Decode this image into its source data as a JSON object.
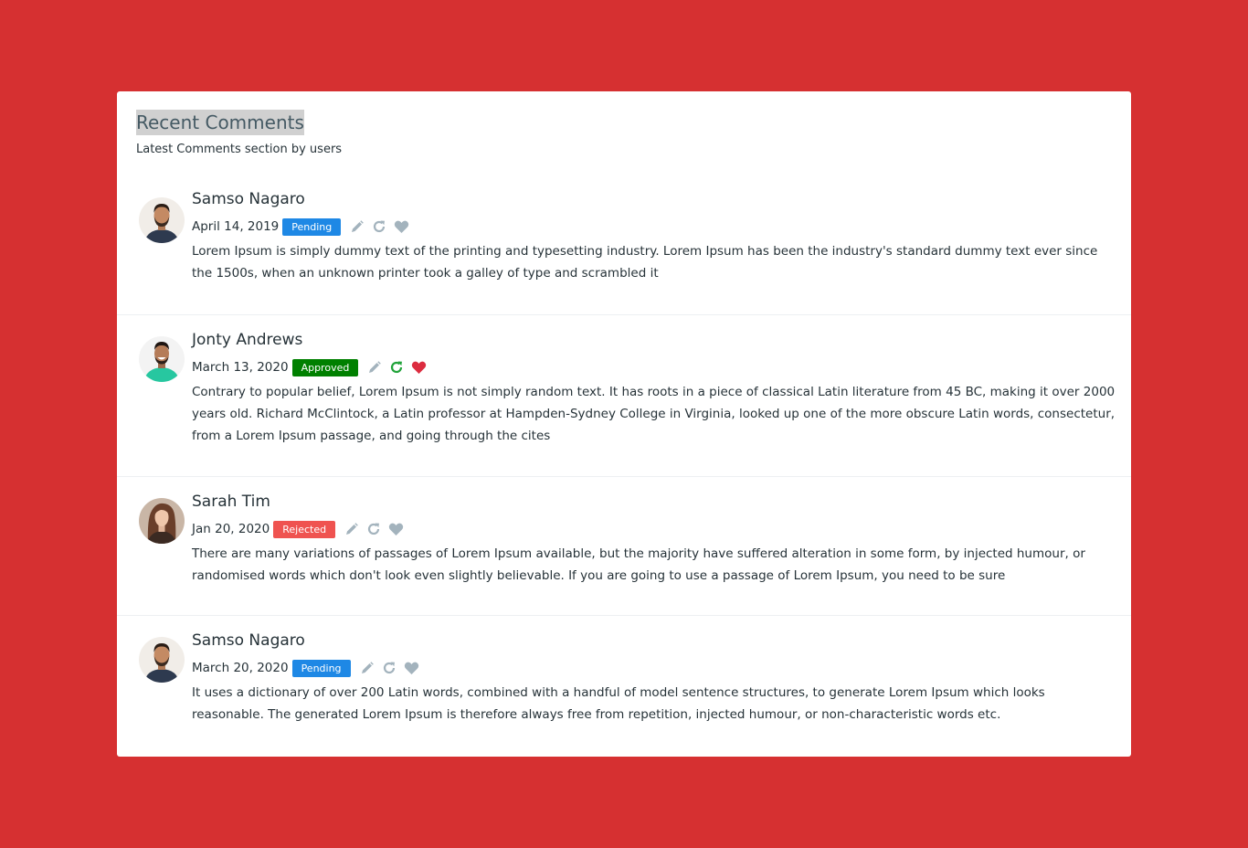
{
  "card": {
    "title": "Recent Comments",
    "subtitle": "Latest Comments section by users"
  },
  "colors": {
    "page_background": "#d63031",
    "pending": "#1e88e5",
    "approved": "#008000",
    "rejected": "#ef5350",
    "icon_muted": "#a3b3bd",
    "refresh_active": "#21a33a",
    "heart_active": "#dc2c3f"
  },
  "comments": [
    {
      "name": "Samso Nagaro",
      "date": "April 14, 2019",
      "status": "Pending",
      "status_color": "#1e88e5",
      "refresh_active": false,
      "liked": false,
      "avatar": "man-beard-navy-shirt",
      "text": "Lorem Ipsum is simply dummy text of the printing and typesetting industry. Lorem Ipsum has been the industry's standard dummy text ever since the 1500s, when an unknown printer took a galley of type and scrambled it"
    },
    {
      "name": "Jonty Andrews",
      "date": "March 13, 2020",
      "status": "Approved",
      "status_color": "#008000",
      "refresh_active": true,
      "liked": true,
      "avatar": "man-smiling-green-shirt",
      "text": "Contrary to popular belief, Lorem Ipsum is not simply random text. It has roots in a piece of classical Latin literature from 45 BC, making it over 2000 years old. Richard McClintock, a Latin professor at Hampden-Sydney College in Virginia, looked up one of the more obscure Latin words, consectetur, from a Lorem Ipsum passage, and going through the cites"
    },
    {
      "name": "Sarah Tim",
      "date": "Jan 20, 2020",
      "status": "Rejected",
      "status_color": "#ef5350",
      "refresh_active": false,
      "liked": false,
      "avatar": "woman-long-hair",
      "text": "There are many variations of passages of Lorem Ipsum available, but the majority have suffered alteration in some form, by injected humour, or randomised words which don't look even slightly believable. If you are going to use a passage of Lorem Ipsum, you need to be sure"
    },
    {
      "name": "Samso Nagaro",
      "date": "March 20, 2020",
      "status": "Pending",
      "status_color": "#1e88e5",
      "refresh_active": false,
      "liked": false,
      "avatar": "man-beard-navy-shirt",
      "text": "It uses a dictionary of over 200 Latin words, combined with a handful of model sentence structures, to generate Lorem Ipsum which looks reasonable. The generated Lorem Ipsum is therefore always free from repetition, injected humour, or non-characteristic words etc."
    }
  ]
}
